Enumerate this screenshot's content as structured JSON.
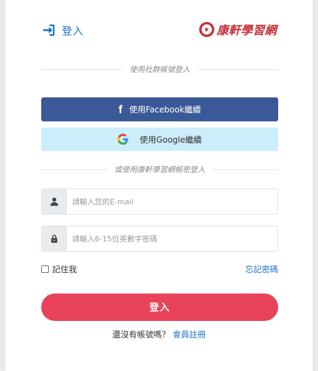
{
  "header": {
    "title": "登入",
    "brand_name": "康軒學習網",
    "colors": {
      "accent": "#1e72c8",
      "brand": "#c8313b"
    }
  },
  "social": {
    "divider_label": "使用社群帳號登入",
    "facebook_icon": "f",
    "facebook_label": "使用Facebook繼續",
    "google_label": "使用Google繼續",
    "colors": {
      "facebook": "#3b5998",
      "google_bg": "#ccedfa"
    }
  },
  "account": {
    "divider_label": "或使用康軒學習網帳密登入",
    "email_placeholder": "請輸入您的E-mail",
    "email_value": "",
    "password_placeholder": "請輸入6-15位英數字密碼",
    "password_value": "",
    "remember_label": "記住我",
    "remember_checked": false,
    "forgot_label": "忘記密碼"
  },
  "submit": {
    "label": "登入",
    "color": "#e8435a"
  },
  "signup": {
    "prompt": "還沒有帳號嗎？",
    "link_label": "會員註冊"
  },
  "icons": [
    "sign-in-icon",
    "brand-logo-icon",
    "facebook-icon",
    "google-icon",
    "user-icon",
    "lock-icon",
    "checkbox"
  ]
}
